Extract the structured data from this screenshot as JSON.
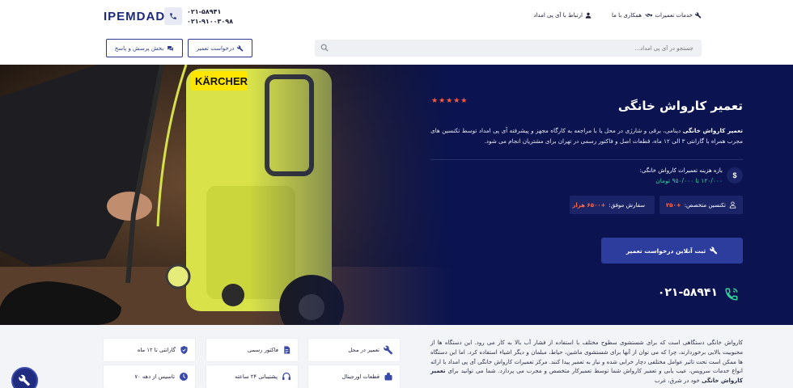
{
  "header": {
    "logo": "IPEMDAD",
    "phones": [
      "۰۲۱-۵۸۹۴۱",
      "۰۲۱-۹۱۰۰۳۰۹۸"
    ],
    "nav": {
      "services": "خدمات تعمیرات",
      "cooperate": "همکاری با ما",
      "contact": "ارتباط با آی پی امداد"
    },
    "repair_request": "درخواست تعمیر",
    "qa_section": "بخش پرسش و پاسخ",
    "search_placeholder": "جستجو در آی پی امداد..."
  },
  "hero": {
    "title": "تعمیر کارواش خانگی",
    "rating": "★★★★★",
    "desc_bold": "تعمیر کارواش خانگی",
    "desc_rest": " دینامی، برقی و شارژی در محل یا با مراجعه به کارگاه مجهز و پیشرفته آی پی امداد توسط تکنسین های مجرب همراه با گارانتی ۳ الی ۱۲ ماه، قطعات اصل و فاکتور رسمی در تهران برای مشتریان انجام می شود.",
    "price_icon": "$",
    "price_label": "بازه هزینه تعمیرات کارواش خانگی:",
    "price_value": "۱۲۰/۰۰۰ تا ۹۵۰/۰۰۰ تومان",
    "technicians_label": "تکنسین متخصص:",
    "technicians_value": "+۲۵۰",
    "orders_label": "سفارش موفق:",
    "orders_value": "+۶۵۰۰ هزار",
    "cta": "ثبت آنلاین درخواست تعمیر",
    "phone": "۰۲۱-۵۸۹۴۱"
  },
  "about": {
    "p1": "کارواش خانگی دستگاهی است که برای شستشوی سطوح مختلف با استفاده از فشار آب بالا به کار می رود. این دستگاه ها از محبوبیت بالایی برخوردارند، چرا که می توان از آنها برای شستشوی ماشین، حیاط، مبلمان و دیگر اشیاء استفاده کرد. اما این دستگاه ها ممکن است تحت تاثیر عوامل مختلفی دچار خرابی شده و نیاز به تعمیر پیدا کنند. مرکز تعمیرات کارواش خانگی آی پی امداد با ارائه انواع خدمات سرویس، عیب یابی و تعمیر کارواش شما توسط تعمیرکار متخصص و مجرب می پردازد. شما می توانید برای",
    "p1_bold": "تعمیر کارواش خانگی",
    "p1_end": "خود در شرق، غرب"
  },
  "features": [
    {
      "label": "تعمیر در محل",
      "icon": "tools-icon"
    },
    {
      "label": "فاکتور رسمی",
      "icon": "invoice-icon"
    },
    {
      "label": "گارانتی تا ۱۲ ماه",
      "icon": "shield-icon"
    },
    {
      "label": "قطعات اورجینال",
      "icon": "parts-icon"
    },
    {
      "label": "پشتیبانی ۲۴ ساعته",
      "icon": "support-icon"
    },
    {
      "label": "تاسیس از دهه ۷۰",
      "icon": "history-icon"
    }
  ],
  "colors": {
    "navy": "#0b1450",
    "brand_blue": "#2c3d9e",
    "accent_orange": "#ff5a3c",
    "price_green": "#35d39a"
  }
}
